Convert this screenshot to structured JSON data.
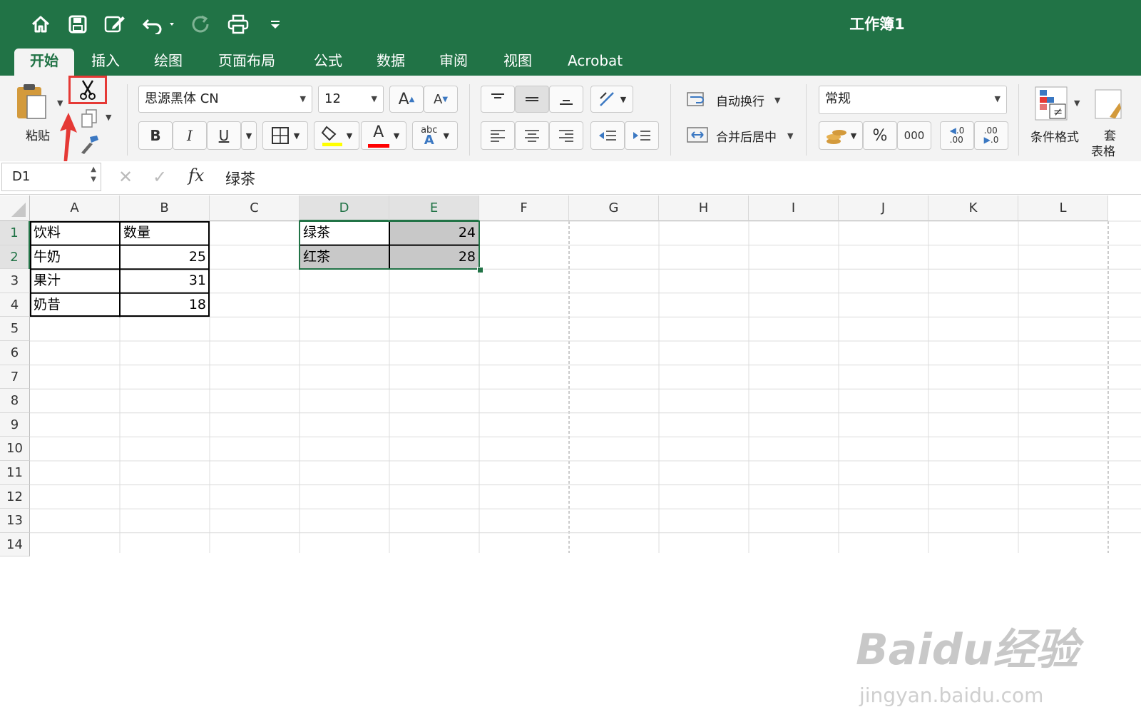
{
  "window": {
    "title": "工作簿1"
  },
  "tabs": [
    "开始",
    "插入",
    "绘图",
    "页面布局",
    "公式",
    "数据",
    "审阅",
    "视图",
    "Acrobat"
  ],
  "ribbon": {
    "paste_label": "粘贴",
    "font_name": "思源黑体 CN",
    "font_size": "12",
    "bold": "B",
    "italic": "I",
    "underline": "U",
    "increase_font": "A",
    "decrease_font": "A",
    "font_color_glyph": "A",
    "abc_top": "abc",
    "abc_bottom": "A",
    "wrap_text": "自动换行",
    "merge_center": "合并后居中",
    "number_format": "常规",
    "percent": "%",
    "thousands": "000",
    "inc_decimal_top": ".0",
    "inc_decimal_bottom": ".00",
    "dec_decimal_top": ".00",
    "dec_decimal_bottom": ".0",
    "conditional_format": "条件格式",
    "table_format_top": "套",
    "table_format_bottom": "表格",
    "highlight_color": "#ffff00",
    "font_color": "#ff0000",
    "cut_highlight_color": "#e53935"
  },
  "formula_bar": {
    "name_box": "D1",
    "fx": "fx",
    "value": "绿茶"
  },
  "columns": [
    "A",
    "B",
    "C",
    "D",
    "E",
    "F",
    "G",
    "H",
    "I",
    "J",
    "K",
    "L"
  ],
  "rows": [
    "1",
    "2",
    "3",
    "4",
    "5",
    "6",
    "7",
    "8",
    "9",
    "10",
    "11",
    "12",
    "13",
    "14"
  ],
  "cells": {
    "A1": "饮料",
    "B1": "数量",
    "A2": "牛奶",
    "B2": "25",
    "A3": "果汁",
    "B3": "31",
    "A4": "奶昔",
    "B4": "18",
    "D1": "绿茶",
    "E1": "24",
    "D2": "红茶",
    "E2": "28"
  },
  "watermark": {
    "logo": "Baidu经验",
    "url": "jingyan.baidu.com"
  },
  "colors": {
    "brand": "#217346",
    "selection_fill": "#c8c8c8"
  }
}
